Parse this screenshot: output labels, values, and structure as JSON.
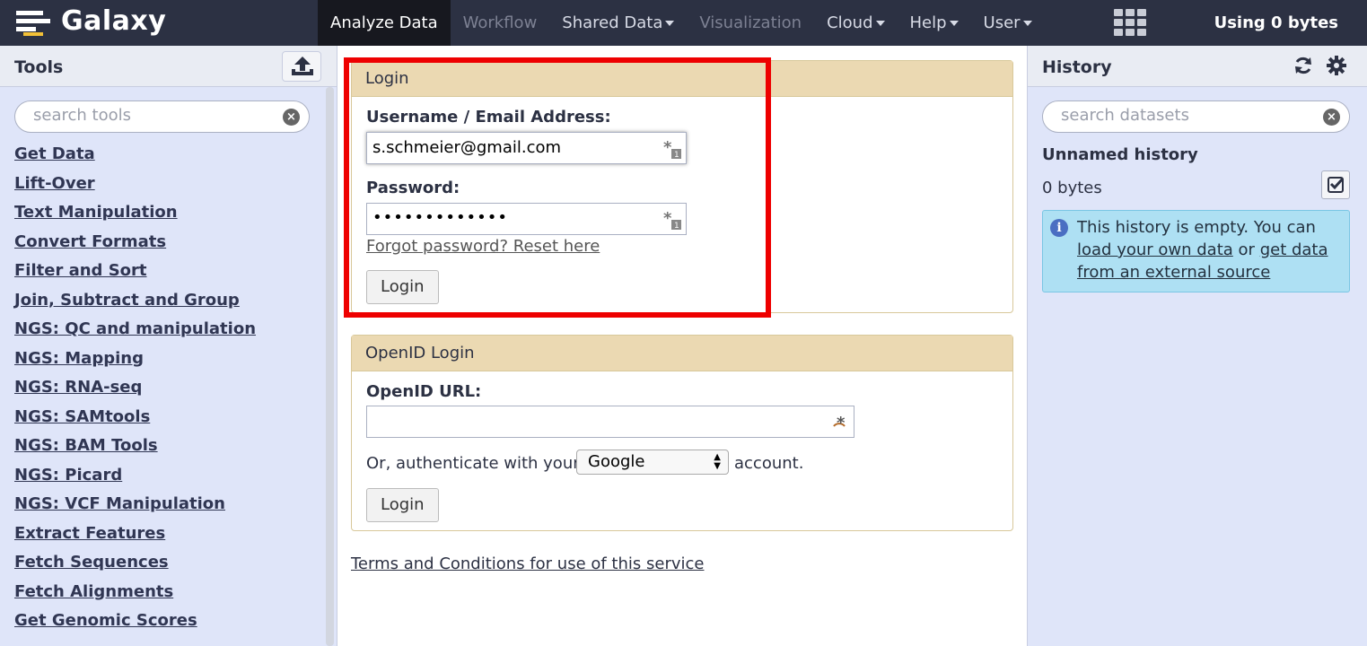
{
  "masthead": {
    "brand": "Galaxy",
    "nav": [
      {
        "label": "Analyze Data",
        "state": "active",
        "dropdown": false
      },
      {
        "label": "Workflow",
        "state": "disabled",
        "dropdown": false
      },
      {
        "label": "Shared Data",
        "state": "normal",
        "dropdown": true
      },
      {
        "label": "Visualization",
        "state": "disabled",
        "dropdown": false
      },
      {
        "label": "Cloud",
        "state": "normal",
        "dropdown": true
      },
      {
        "label": "Help",
        "state": "normal",
        "dropdown": true
      },
      {
        "label": "User",
        "state": "normal",
        "dropdown": true
      }
    ],
    "usage": "Using 0 bytes"
  },
  "tools_panel": {
    "title": "Tools",
    "search_placeholder": "search tools",
    "sections": [
      "Get Data",
      "Lift-Over",
      "Text Manipulation",
      "Convert Formats",
      "Filter and Sort",
      "Join, Subtract and Group",
      "NGS: QC and manipulation",
      "NGS: Mapping",
      "NGS: RNA-seq",
      "NGS: SAMtools",
      "NGS: BAM Tools",
      "NGS: Picard",
      "NGS: VCF Manipulation",
      "Extract Features",
      "Fetch Sequences",
      "Fetch Alignments",
      "Get Genomic Scores"
    ]
  },
  "login_form": {
    "title": "Login",
    "username_label": "Username / Email Address:",
    "username_value": "s.schmeier@gmail.com",
    "password_label": "Password:",
    "password_masked": "•••••••••••••",
    "forgot_text": "Forgot password? Reset here",
    "submit_label": "Login",
    "highlight_color": "#ee0000"
  },
  "openid_form": {
    "title": "OpenID Login",
    "url_label": "OpenID URL:",
    "url_value": "",
    "auth_prefix": "Or, authenticate with your",
    "provider_selected": "Google",
    "auth_suffix": "account.",
    "submit_label": "Login"
  },
  "terms_link": "Terms and Conditions for use of this service",
  "history_panel": {
    "title": "History",
    "search_placeholder": "search datasets",
    "history_name": "Unnamed history",
    "size": "0 bytes",
    "empty_message_prefix": "This history is empty. You can",
    "link_load": "load your own data",
    "mid_or": "or",
    "link_get": "get data from an external source"
  },
  "colors": {
    "masthead": "#2c3143",
    "panel_bg": "#dfe5f9",
    "form_header": "#ebd9b2",
    "info_box": "#aee0f3"
  }
}
